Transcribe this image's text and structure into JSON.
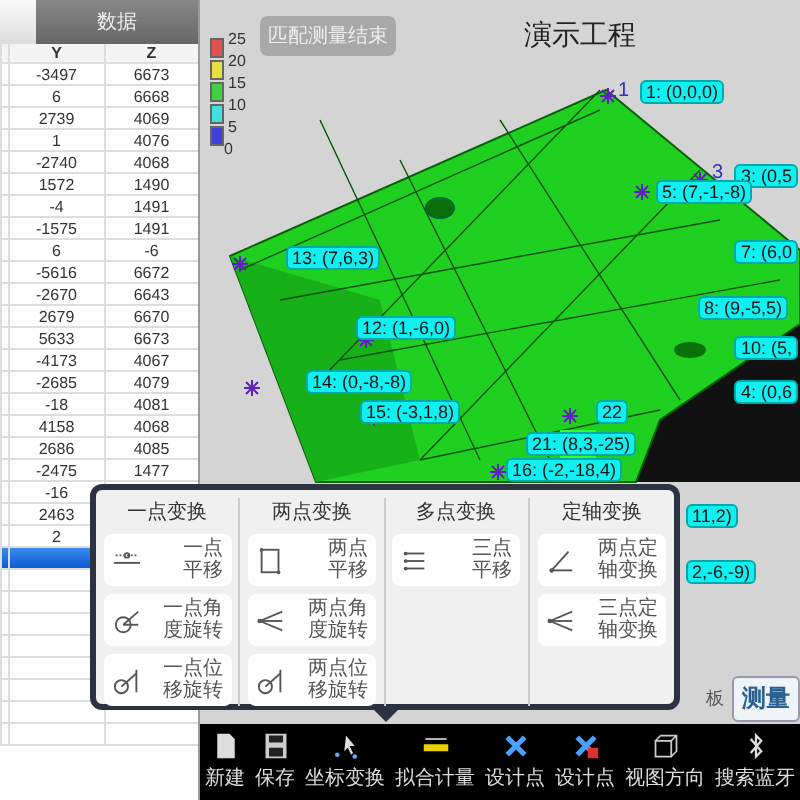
{
  "data_panel": {
    "tab": "数据",
    "columns": [
      "Y",
      "Z"
    ],
    "rows": [
      {
        "cells": [
          "-3497",
          "6673"
        ],
        "selected": false
      },
      {
        "cells": [
          "6",
          "6668"
        ],
        "selected": false
      },
      {
        "cells": [
          "2739",
          "4069"
        ],
        "selected": false
      },
      {
        "cells": [
          "1",
          "4076"
        ],
        "selected": false
      },
      {
        "cells": [
          "-2740",
          "4068"
        ],
        "selected": false
      },
      {
        "cells": [
          "1572",
          "1490"
        ],
        "selected": false
      },
      {
        "cells": [
          "-4",
          "1491"
        ],
        "selected": false
      },
      {
        "cells": [
          "-1575",
          "1491"
        ],
        "selected": false
      },
      {
        "cells": [
          "6",
          "-6"
        ],
        "selected": false
      },
      {
        "cells": [
          "-5616",
          "6672"
        ],
        "selected": false
      },
      {
        "cells": [
          "-2670",
          "6643"
        ],
        "selected": false
      },
      {
        "cells": [
          "2679",
          "6670"
        ],
        "selected": false
      },
      {
        "cells": [
          "5633",
          "6673"
        ],
        "selected": false
      },
      {
        "cells": [
          "-4173",
          "4067"
        ],
        "selected": false
      },
      {
        "cells": [
          "-2685",
          "4079"
        ],
        "selected": false
      },
      {
        "cells": [
          "-18",
          "4081"
        ],
        "selected": false
      },
      {
        "cells": [
          "4158",
          "4068"
        ],
        "selected": false
      },
      {
        "cells": [
          "2686",
          "4085"
        ],
        "selected": false
      },
      {
        "cells": [
          "-2475",
          "1477"
        ],
        "selected": false
      },
      {
        "cells": [
          "-16"
        ],
        "selected": false
      },
      {
        "cells": [
          "2463"
        ],
        "selected": false
      },
      {
        "cells": [
          "2"
        ],
        "selected": false
      },
      {
        "selected": true
      }
    ]
  },
  "viewport": {
    "title": "演示工程",
    "button": "匹配测量结束",
    "legend": {
      "items": [
        {
          "label": "25",
          "color": "#e05050"
        },
        {
          "label": "20",
          "color": "#e8e040"
        },
        {
          "label": "15",
          "color": "#40d040"
        },
        {
          "label": "10",
          "color": "#40e0e0"
        },
        {
          "label": "5",
          "color": "#4040e0"
        }
      ],
      "base_label": "0"
    },
    "marker_numbers": [
      "1",
      "3"
    ],
    "point_labels": [
      {
        "text": "1: (0,0,0)"
      },
      {
        "text": "3: (0,5"
      },
      {
        "text": "5: (7,-1,-8)"
      },
      {
        "text": "13: (7,6,3)"
      },
      {
        "text": "7: (6,0"
      },
      {
        "text": "8: (9,-5,5)"
      },
      {
        "text": "12: (1,-6,0)"
      },
      {
        "text": "10: (5,"
      },
      {
        "text": "14: (0,-8,-8)"
      },
      {
        "text": "4: (0,6"
      },
      {
        "text": "15: (-3,1,8)"
      },
      {
        "text": "22"
      },
      {
        "text": "21: (8,3,-25)"
      },
      {
        "text": "16: (-2,-18,4)"
      },
      {
        "text": "11,2)"
      },
      {
        "text": "2,-6,-9)"
      }
    ],
    "side_tabs": [
      {
        "label": "板"
      },
      {
        "label": "测量"
      }
    ]
  },
  "transform_popup": {
    "groups": [
      {
        "title": "一点变换",
        "buttons": [
          {
            "label": "一点平移",
            "kind": "shift"
          },
          {
            "label": "一点角度旋转",
            "kind": "angle"
          },
          {
            "label": "一点位移旋转",
            "kind": "offset"
          }
        ]
      },
      {
        "title": "两点变换",
        "buttons": [
          {
            "label": "两点平移",
            "kind": "frame"
          },
          {
            "label": "两点角度旋转",
            "kind": "fan"
          },
          {
            "label": "两点位移旋转",
            "kind": "offset"
          }
        ]
      },
      {
        "title": "多点变换",
        "buttons": [
          {
            "label": "三点平移",
            "kind": "dots"
          }
        ]
      },
      {
        "title": "定轴变换",
        "buttons": [
          {
            "label": "两点定轴变换",
            "kind": "axis"
          },
          {
            "label": "三点定轴变换",
            "kind": "fan"
          }
        ]
      }
    ]
  },
  "toolbar": [
    {
      "label": "新建",
      "kind": "new"
    },
    {
      "label": "保存",
      "kind": "save"
    },
    {
      "label": "坐标变换",
      "kind": "transform"
    },
    {
      "label": "拟合计量",
      "kind": "ruler"
    },
    {
      "label": "设计点",
      "kind": "cross"
    },
    {
      "label": "设计点",
      "kind": "cross-alert"
    },
    {
      "label": "视图方向",
      "kind": "cube"
    },
    {
      "label": "搜索蓝牙",
      "kind": "bluetooth"
    }
  ]
}
